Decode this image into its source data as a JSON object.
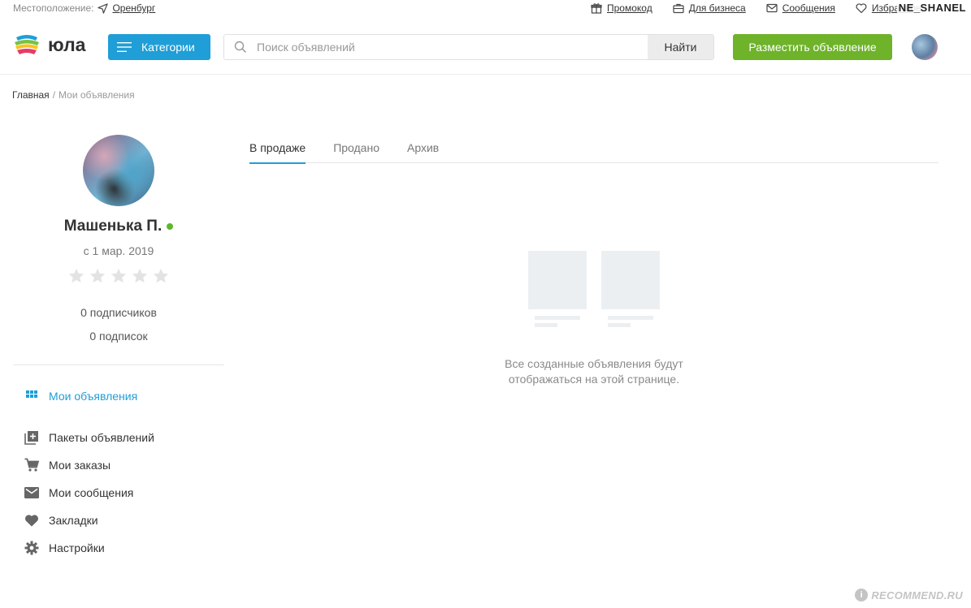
{
  "topbar": {
    "location_label": "Местоположение:",
    "city": "Оренбург",
    "links": [
      {
        "label": "Промокод",
        "icon": "gift-icon"
      },
      {
        "label": "Для бизнеса",
        "icon": "briefcase-icon"
      },
      {
        "label": "Сообщения",
        "icon": "envelope-icon"
      },
      {
        "label": "Избранное",
        "icon": "heart-icon"
      }
    ],
    "watermark": "NE_SHANEL"
  },
  "header": {
    "logo_text": "юла",
    "categories_label": "Категории",
    "search_placeholder": "Поиск объявлений",
    "search_value": "",
    "search_button": "Найти",
    "post_button": "Разместить объявление"
  },
  "breadcrumb": {
    "home": "Главная",
    "separator": "/",
    "current": "Мои объявления"
  },
  "profile": {
    "name": "Машенька П.",
    "online": true,
    "since": "с 1 мар. 2019",
    "rating": 0,
    "rating_max": 5,
    "followers": "0 подписчиков",
    "following": "0 подписок"
  },
  "menu": [
    {
      "label": "Мои объявления",
      "icon": "grid-icon",
      "active": true
    },
    {
      "label": "Пакеты объявлений",
      "icon": "library-add-icon",
      "active": false
    },
    {
      "label": "Мои заказы",
      "icon": "cart-icon",
      "active": false
    },
    {
      "label": "Мои сообщения",
      "icon": "mail-icon",
      "active": false
    },
    {
      "label": "Закладки",
      "icon": "heart-icon",
      "active": false
    },
    {
      "label": "Настройки",
      "icon": "gear-icon",
      "active": false
    }
  ],
  "tabs": [
    {
      "label": "В продаже",
      "active": true
    },
    {
      "label": "Продано",
      "active": false
    },
    {
      "label": "Архив",
      "active": false
    }
  ],
  "empty_state": {
    "line1": "Все созданные объявления будут",
    "line2": "отображаться на этой странице."
  },
  "watermark_bottom": "RECOMMEND.RU",
  "colors": {
    "accent_blue": "#1f9ed7",
    "post_green": "#6eb32a",
    "online_green": "#5cb82b",
    "star_gray": "#e3e3e3"
  }
}
